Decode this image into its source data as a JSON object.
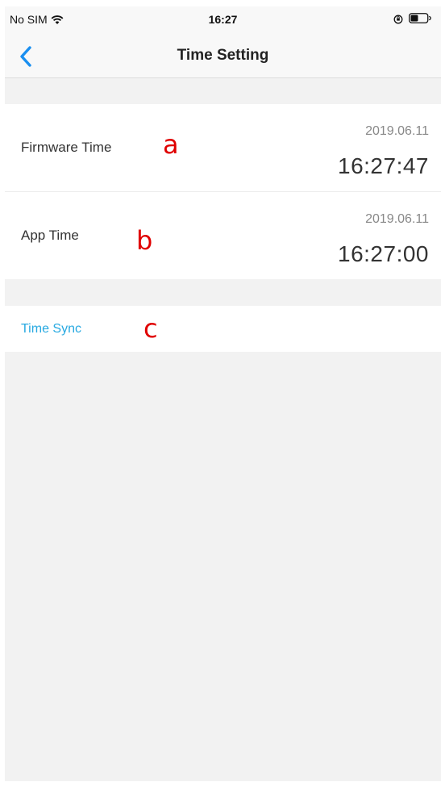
{
  "status_bar": {
    "carrier": "No SIM",
    "time": "16:27",
    "icons": [
      "wifi-icon",
      "orientation-lock-icon",
      "battery-icon"
    ]
  },
  "nav": {
    "title": "Time Setting",
    "back_icon": "chevron-left-icon"
  },
  "rows": {
    "firmware": {
      "label": "Firmware Time",
      "date": "2019.06.11",
      "time": "16:27:47",
      "marker": "a"
    },
    "app": {
      "label": "App Time",
      "date": "2019.06.11",
      "time": "16:27:00",
      "marker": "b"
    },
    "sync": {
      "label": "Time Sync",
      "marker": "c"
    }
  },
  "colors": {
    "accent": "#27a9e1",
    "background": "#f2f2f2",
    "marker": "#e00000"
  }
}
